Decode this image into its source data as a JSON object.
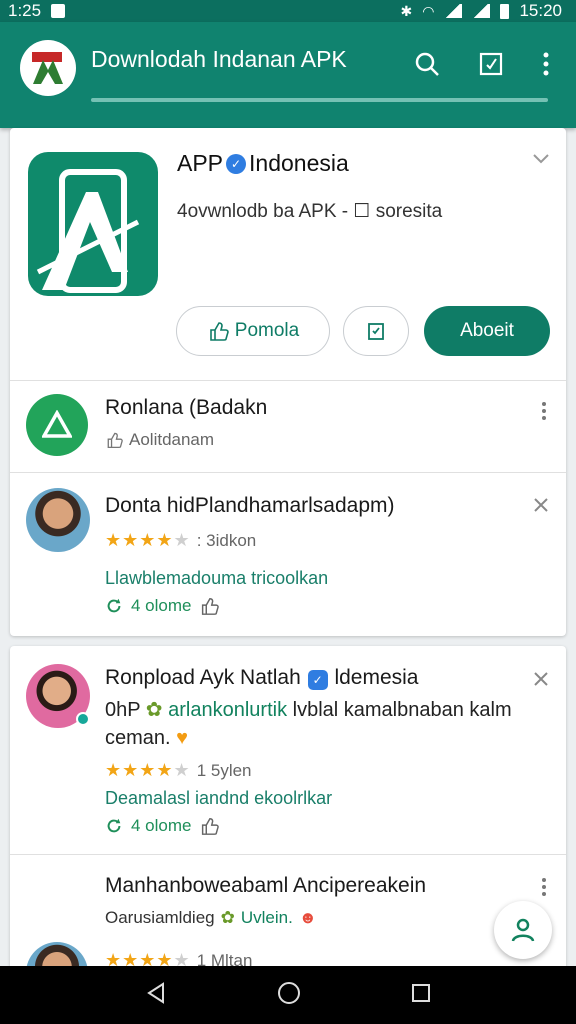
{
  "status_bar": {
    "time": "1:25",
    "clock": "15:20"
  },
  "app_bar": {
    "title": "Downlodah Indanan APK",
    "icons": [
      "app-logo-icon",
      "search-icon",
      "edit-icon",
      "more-vert-icon"
    ]
  },
  "hero": {
    "title_part1": "APP",
    "title_part2": "Indonesia",
    "subtitle": "4ovwnlodb ba APK - ☐ soresita",
    "buttons": {
      "share": "Pomola",
      "save_icon": "bookmark-icon",
      "primary": "Aboeit"
    }
  },
  "items": [
    {
      "name": "Ronlana (Badakn",
      "meta": "Aolitdanam"
    },
    {
      "name": "Donta hidPlandhamarlsadapm)",
      "rating": 4,
      "rating_text": ": 3idkon",
      "link": "Llawblemadouma tricoolkan",
      "action": "4 olome"
    }
  ],
  "post": {
    "name": "Ronpload Ayk Natlah",
    "name_suffix": "ldemesia",
    "body_prefix": "0hP",
    "body_highlight": "arlankonlurtik",
    "body_rest": "lvblal kamalbnaban kalm ceman.",
    "rating": 4,
    "rating_text": "1 5ylen",
    "link": "Deamalasl iandnd ekoolrlkar",
    "action": "4 olome",
    "next_name": "Manhanboweabaml Ancipereakein",
    "next_meta_prefix": "Oarusiamldieg",
    "next_meta_highlight": "Uvlein.",
    "next_rating_text": "1 Mltan"
  },
  "colors": {
    "primary": "#10836f",
    "accent": "#0f7c66",
    "star": "#f2a516",
    "link": "#1a7f6a"
  }
}
